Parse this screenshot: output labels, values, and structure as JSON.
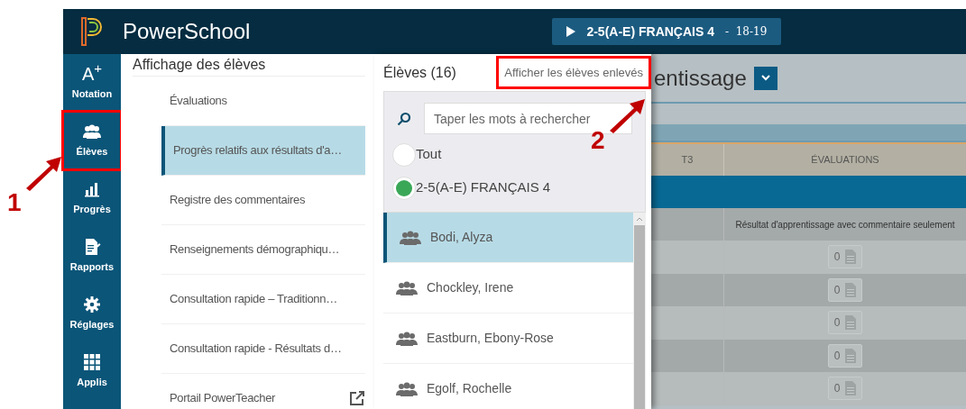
{
  "header": {
    "logo_text": "PowerSchool",
    "class_button": {
      "label": "2-5(A-E) FRANÇAIS 4",
      "separator": "-",
      "term": "18-19"
    }
  },
  "sidebar": {
    "items": [
      {
        "label": "Notation",
        "kind": "grade",
        "glyph": "A$^{+}$"
      },
      {
        "label": "Élèves",
        "kind": "students"
      },
      {
        "label": "Progrès",
        "kind": "chart"
      },
      {
        "label": "Rapports",
        "kind": "report"
      },
      {
        "label": "Réglages",
        "kind": "settings"
      },
      {
        "label": "Applis",
        "kind": "apps"
      }
    ]
  },
  "view_panel": {
    "title": "Affichage des élèves",
    "items": [
      {
        "label": "Évaluations",
        "selected": false
      },
      {
        "label": "Progrès relatifs aux résultats d'a…",
        "selected": true
      },
      {
        "label": "Registre des commentaires",
        "selected": false
      },
      {
        "label": "Renseignements démographiqu…",
        "selected": false
      },
      {
        "label": "Consultation rapide – Traditionn…",
        "selected": false
      },
      {
        "label": "Consultation rapide - Résultats d…",
        "selected": false
      },
      {
        "label": "Portail PowerTeacher",
        "selected": false,
        "kind": "external"
      }
    ]
  },
  "students_panel": {
    "title": "Élèves (16)",
    "link": "Afficher les élèves enlevés",
    "search": {
      "placeholder": "Taper les mots à rechercher"
    },
    "filters": [
      {
        "label": "Tout",
        "selected": false
      },
      {
        "label": "2-5(A-E) FRANÇAIS 4",
        "selected": true,
        "color": "#3aa757"
      }
    ],
    "students": [
      {
        "name": "Bodi, Alyza",
        "selected": true
      },
      {
        "name": "Chockley, Irene",
        "selected": false
      },
      {
        "name": "Eastburn, Ebony-Rose",
        "selected": false
      },
      {
        "name": "Egolf, Rochelle",
        "selected": false
      }
    ]
  },
  "background_page": {
    "title": "entissage",
    "columns": [
      "T3",
      "ÉVALUATIONS"
    ],
    "subheader": "Résultat d'apprentissage avec commentaire seulement",
    "rows": [
      {
        "value": "0"
      },
      {
        "value": "0"
      },
      {
        "value": "0"
      },
      {
        "value": "0"
      },
      {
        "value": "0"
      }
    ]
  },
  "annotations": [
    {
      "number": "1"
    },
    {
      "number": "2"
    }
  ]
}
